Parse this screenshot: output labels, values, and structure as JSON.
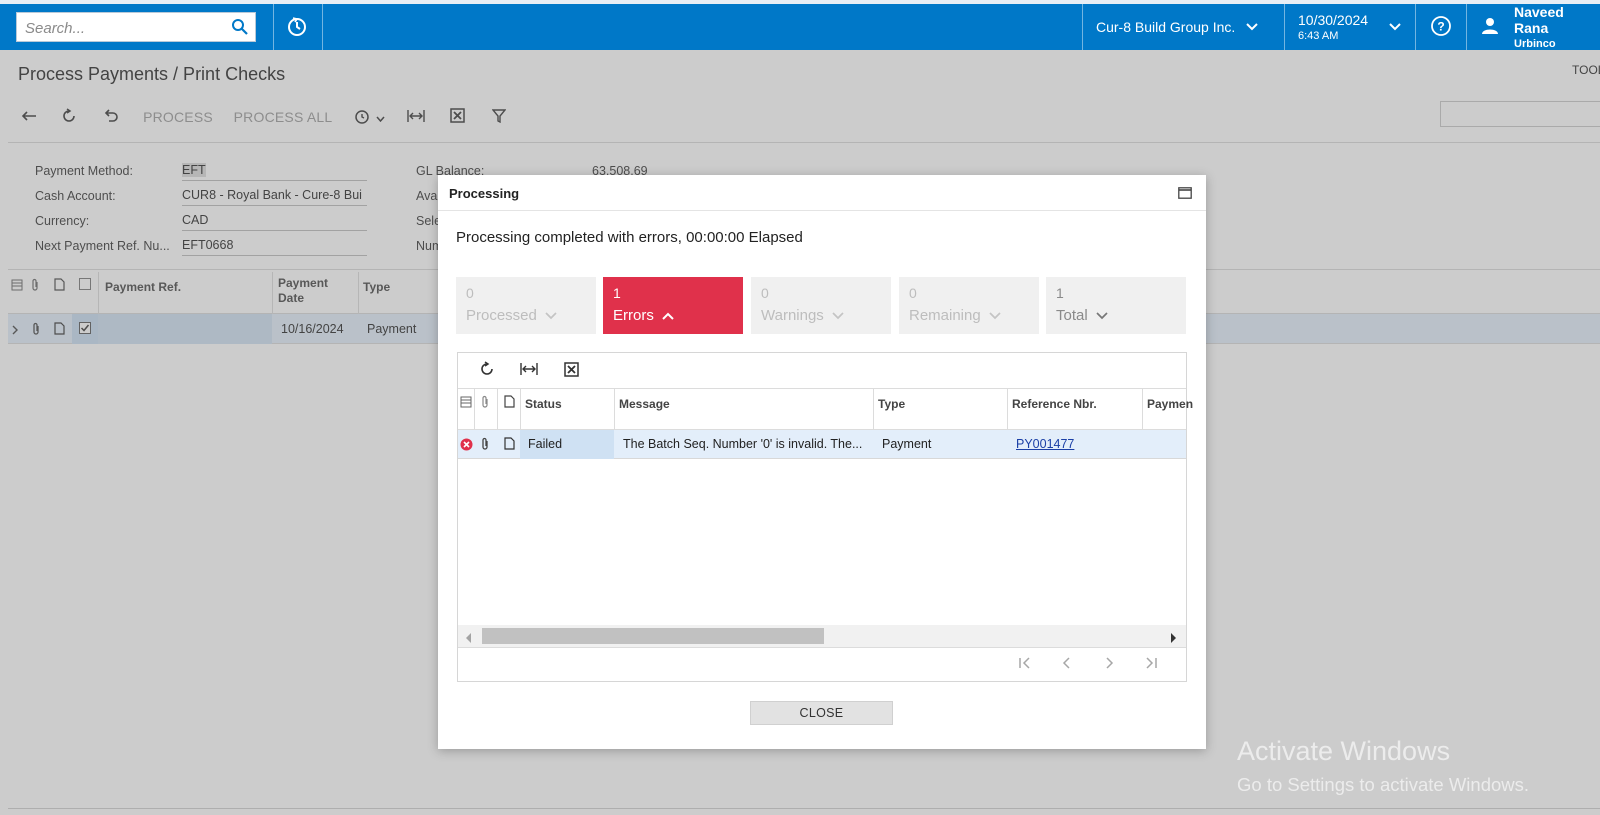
{
  "topbar": {
    "search_placeholder": "Search...",
    "company": "Cur-8 Build Group Inc.",
    "date": "10/30/2024",
    "time": "6:43 AM",
    "user_name": "Naveed Rana",
    "user_org": "Urbinco"
  },
  "page": {
    "title": "Process Payments / Print Checks",
    "tools_label": "TOOL",
    "toolbar": {
      "process_label": "PROCESS",
      "process_all_label": "PROCESS ALL"
    }
  },
  "form": {
    "payment_method_label": "Payment Method:",
    "payment_method_value": "EFT",
    "cash_account_label": "Cash Account:",
    "cash_account_value": "CUR8 - Royal Bank - Cure-8 Bui",
    "currency_label": "Currency:",
    "currency_value": "CAD",
    "next_ref_label": "Next Payment Ref. Nu...",
    "next_ref_value": "EFT0668",
    "gl_balance_label": "GL Balance:",
    "gl_balance_value": "63,508.69",
    "avail_label": "Avai",
    "sele_label": "Sele",
    "num_label": "Num"
  },
  "grid": {
    "headers": [
      "Payment Ref.",
      "Payment Date",
      "Type"
    ],
    "header_date_line1": "Payment",
    "header_date_line2": "Date",
    "row": {
      "payment_ref": "",
      "payment_date": "10/16/2024",
      "type": "Payment"
    }
  },
  "dialog": {
    "title": "Processing",
    "message": "Processing completed with errors, 00:00:00 Elapsed",
    "stats": [
      {
        "count": "0",
        "label": "Processed"
      },
      {
        "count": "1",
        "label": "Errors"
      },
      {
        "count": "0",
        "label": "Warnings"
      },
      {
        "count": "0",
        "label": "Remaining"
      },
      {
        "count": "1",
        "label": "Total"
      }
    ],
    "inner_grid": {
      "headers": [
        "Status",
        "Message",
        "Type",
        "Reference Nbr.",
        "Paymen"
      ],
      "row": {
        "status": "Failed",
        "message": "The Batch Seq. Number '0' is invalid. The...",
        "type": "Payment",
        "reference": "PY001477"
      }
    },
    "close_label": "CLOSE"
  },
  "watermark": {
    "line1": "Activate Windows",
    "line2": "Go to Settings to activate Windows."
  },
  "colors": {
    "brand": "#0078c8",
    "error": "#e0314b",
    "link": "#1a3fa6"
  }
}
